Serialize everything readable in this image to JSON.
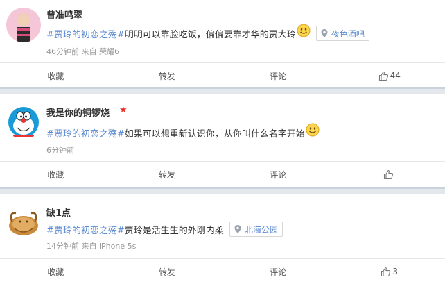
{
  "posts": [
    {
      "username": "曾准鸣翠",
      "topic": "#贾玲的初恋之殇#",
      "text": "明明可以靠脸吃饭，偏偏要靠才华的贾大玲",
      "location": "夜色酒吧",
      "meta": "46分钟前 来自 荣耀6",
      "actions": {
        "favorite": "收藏",
        "repost": "转发",
        "comment": "评论",
        "like_count": "44"
      }
    },
    {
      "username": "我是你的铜锣烧",
      "topic": "#贾玲的初恋之殇#",
      "text": "如果可以想重新认识你，从你叫什么名字开始",
      "meta": "6分钟前",
      "actions": {
        "favorite": "收藏",
        "repost": "转发",
        "comment": "评论",
        "like_count": ""
      }
    },
    {
      "username": "缺1点",
      "topic": "#贾玲的初恋之殇#",
      "text": "贾玲是活生生的外刚内柔",
      "location": "北海公园",
      "meta": "14分钟前 来自 iPhone 5s",
      "actions": {
        "favorite": "收藏",
        "repost": "转发",
        "comment": "评论",
        "like_count": "3"
      }
    }
  ],
  "icons": {
    "emoji": "smiley-icon",
    "location": "location-pin-icon",
    "like": "thumbs-up-icon",
    "vip_star": "star-icon"
  },
  "colors": {
    "topic_link": "#5b8ad0",
    "separator": "#e4e7ec",
    "star": "#e8322b"
  }
}
